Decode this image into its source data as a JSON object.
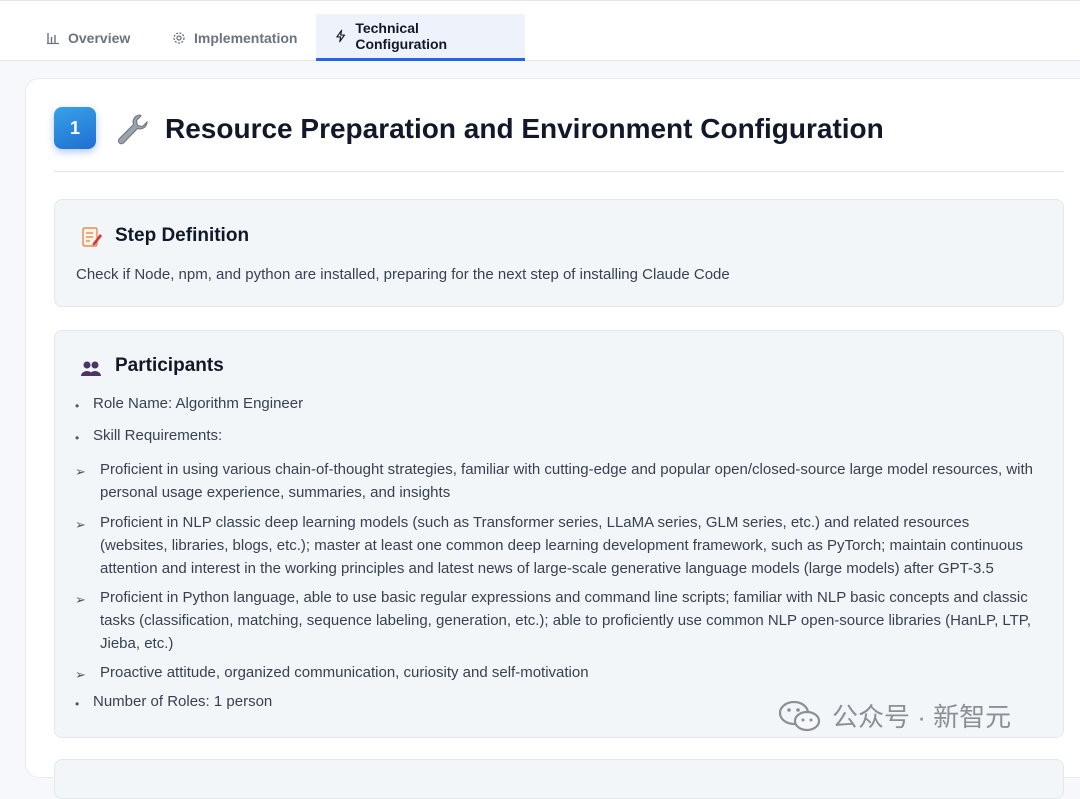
{
  "tabs": [
    {
      "label": "Overview",
      "icon": "bar-chart-icon",
      "active": false
    },
    {
      "label": "Implementation",
      "icon": "gear-icon",
      "active": false
    },
    {
      "label": "Technical Configuration",
      "icon": "lightning-icon",
      "active": true
    }
  ],
  "section": {
    "number": "1",
    "title": "Resource Preparation and Environment Configuration",
    "icon": "wrench-icon"
  },
  "step_definition": {
    "heading": "Step Definition",
    "icon": "memo-icon",
    "text": "Check if Node, npm, and python are installed, preparing for the next step of installing Claude Code"
  },
  "participants": {
    "heading": "Participants",
    "icon": "people-icon",
    "role_name": "Role Name: Algorithm Engineer",
    "skill_label": "Skill Requirements:",
    "skills": [
      "Proficient in using various chain-of-thought strategies, familiar with cutting-edge and popular open/closed-source large model resources, with personal usage experience, summaries, and insights",
      "Proficient in NLP classic deep learning models (such as Transformer series, LLaMA series, GLM series, etc.) and related resources (websites, libraries, blogs, etc.); master at least one common deep learning development framework, such as PyTorch; maintain continuous attention and interest in the working principles and latest news of large-scale generative language models (large models) after GPT-3.5",
      "Proficient in Python language, able to use basic regular expressions and command line scripts; familiar with NLP basic concepts and classic tasks (classification, matching, sequence labeling, generation, etc.); able to proficiently use common NLP open-source libraries (HanLP, LTP, Jieba, etc.)",
      "Proactive attitude, organized communication, curiosity and self-motivation"
    ],
    "role_count": "Number of Roles: 1 person"
  },
  "watermark": {
    "text": "公众号 · 新智元",
    "icon": "wechat-icon"
  },
  "colors": {
    "accent": "#2563eb",
    "badge_gradient_start": "#38a1e8",
    "badge_gradient_end": "#1f6fd1",
    "panel_bg": "#f3f6f9"
  }
}
